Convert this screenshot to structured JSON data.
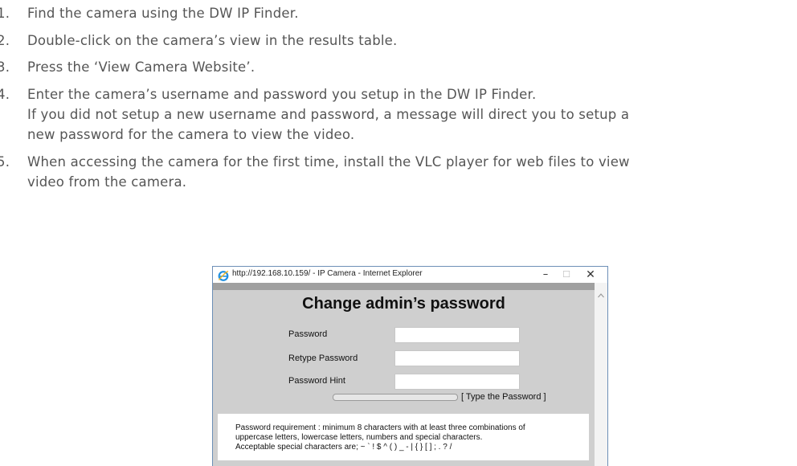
{
  "instructions": {
    "steps": [
      {
        "number": "1.",
        "text": "Find the camera using the DW IP Finder."
      },
      {
        "number": "2.",
        "text": "Double-click on the camera’s view in the results table."
      },
      {
        "number": "3.",
        "text": "Press the ‘View Camera Website’."
      },
      {
        "number": "4.",
        "text": "Enter the camera’s username and password you setup in the DW IP Finder.",
        "continuation": [
          "If you did not setup a new username and password, a message will direct you to setup a",
          "new password for the camera to view the video."
        ]
      },
      {
        "number": "5.",
        "text": "When accessing the camera for the first time, install the VLC player for web files to view",
        "continuation": [
          "video from the camera."
        ]
      }
    ]
  },
  "browser_window": {
    "title": "http://192.168.10.159/ - IP Camera - Internet Explorer",
    "icon": "internet-explorer-icon",
    "controls": {
      "minimize": "–",
      "maximize": "☐",
      "close": "✕"
    }
  },
  "password_form": {
    "title": "Change admin’s password",
    "fields": [
      {
        "label": "Password",
        "value": "",
        "type": "password"
      },
      {
        "label": "Retype Password",
        "value": "",
        "type": "password"
      },
      {
        "label": "Password Hint",
        "value": "",
        "type": "text"
      }
    ],
    "strength_text": "[ Type the Password ]",
    "strength_level": 0,
    "requirements": [
      "Password requirement : minimum 8 characters with at least three combinations of",
      "uppercase letters, lowercase letters, numbers and special characters.",
      "Acceptable special characters are; ~ ` ! $ ^ ( ) _ - | { } [ ] ; . ? /"
    ]
  },
  "colors": {
    "form_background": "#cfcfcf",
    "window_border": "#6d8fb7",
    "text": "#555555"
  }
}
